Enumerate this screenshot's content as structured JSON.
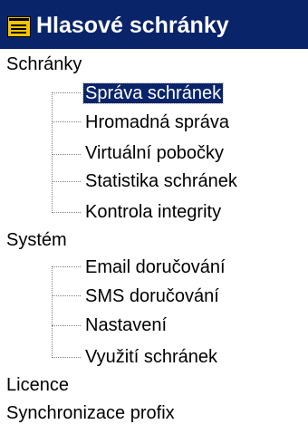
{
  "header": {
    "title": "Hlasové schránky",
    "icon": "mailbox-list-icon",
    "background": "#0a246a",
    "icon_color": "#f4c400"
  },
  "tree": {
    "groups": [
      {
        "label": "Schránky",
        "children": [
          {
            "label": "Správa schránek",
            "selected": true
          },
          {
            "label": "Hromadná správa",
            "selected": false
          },
          {
            "label": "Virtuální pobočky",
            "selected": false
          },
          {
            "label": "Statistika schránek",
            "selected": false
          },
          {
            "label": "Kontrola integrity",
            "selected": false
          }
        ]
      },
      {
        "label": "Systém",
        "children": [
          {
            "label": "Email doručování",
            "selected": false
          },
          {
            "label": "SMS doručování",
            "selected": false
          },
          {
            "label": "Nastavení",
            "selected": false
          },
          {
            "label": "Využití schránek",
            "selected": false
          }
        ]
      },
      {
        "label": "Licence",
        "children": []
      },
      {
        "label": "Synchronizace profix",
        "children": []
      }
    ]
  }
}
